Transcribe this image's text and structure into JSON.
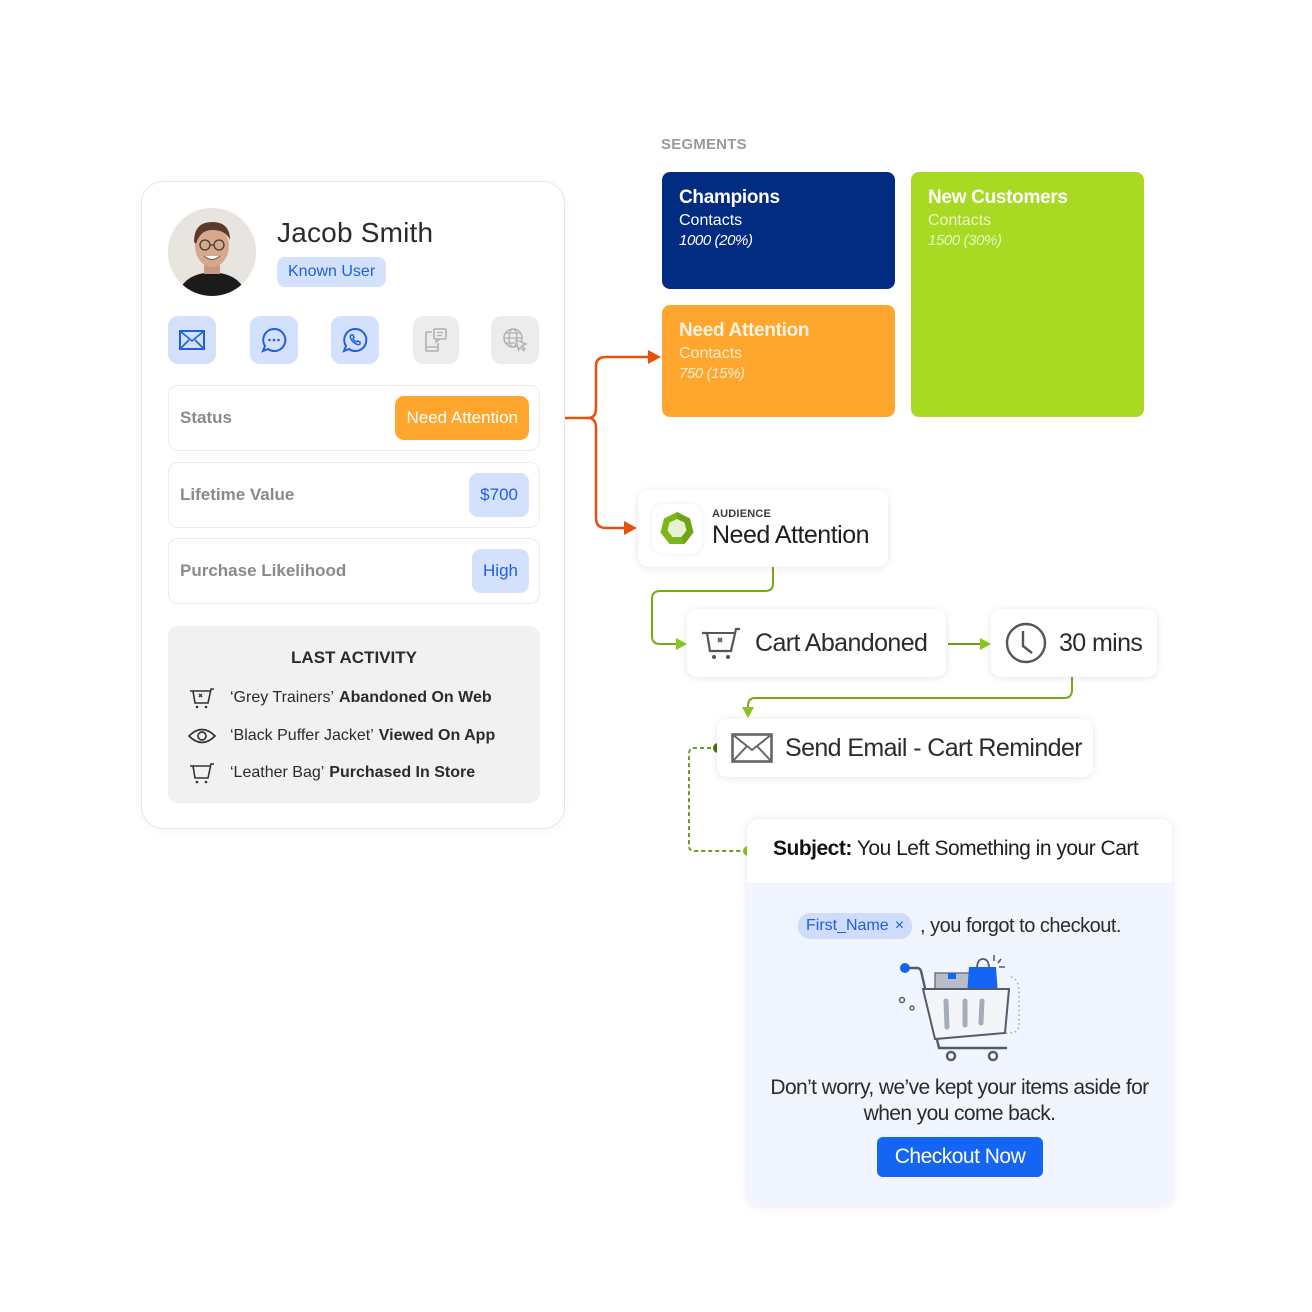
{
  "profile": {
    "name": "Jacob Smith",
    "badge": "Known User",
    "channels": [
      {
        "icon": "email-icon",
        "state": "active"
      },
      {
        "icon": "chat-bubble-icon",
        "state": "active"
      },
      {
        "icon": "whatsapp-icon",
        "state": "active"
      },
      {
        "icon": "mobile-message-icon",
        "state": "inactive"
      },
      {
        "icon": "web-globe-cursor-icon",
        "state": "inactive"
      }
    ],
    "attributes": [
      {
        "label": "Status",
        "value": "Need Attention",
        "style": "orange"
      },
      {
        "label": "Lifetime Value",
        "value": "$700",
        "style": "blue"
      },
      {
        "label": "Purchase Likelihood",
        "value": "High",
        "style": "blue"
      }
    ],
    "last_activity": {
      "title": "LAST ACTIVITY",
      "items": [
        {
          "icon": "cart-abandoned-icon",
          "item": "‘Grey Trainers’",
          "action": "Abandoned On Web"
        },
        {
          "icon": "eye-icon",
          "item": "‘Black Puffer Jacket’",
          "action": "Viewed On App"
        },
        {
          "icon": "cart-icon",
          "item": "‘Leather Bag’",
          "action": "Purchased In Store"
        }
      ]
    }
  },
  "segments": {
    "label": "SEGMENTS",
    "items": [
      {
        "name": "Champions",
        "sub": "Contacts",
        "count": "1000 (20%)",
        "color": "#022b82"
      },
      {
        "name": "New Customers",
        "sub": "Contacts",
        "count": "1500 (30%)",
        "color": "#a8d923"
      },
      {
        "name": "Need Attention",
        "sub": "Contacts",
        "count": "750 (15%)",
        "color": "#fea62e"
      }
    ]
  },
  "flow": {
    "audience": {
      "kicker": "AUDIENCE",
      "title": "Need Attention"
    },
    "trigger": {
      "label": "Cart Abandoned"
    },
    "wait": {
      "label": "30 mins"
    },
    "action": {
      "label": "Send Email - Cart Reminder"
    }
  },
  "email": {
    "subject_label": "Subject:",
    "subject": "You Left Something in your Cart",
    "token": "First_Name",
    "token_remove": "×",
    "greeting": ", you forgot to checkout.",
    "body_line1": "Don’t worry, we’ve kept your items aside for",
    "body_line2": "when you come back.",
    "cta": "Checkout Now"
  },
  "colors": {
    "accent_blue": "#1565f5",
    "orange": "#fea62e",
    "connector_orange": "#e8500e",
    "connector_green": "#8cc31c",
    "navy": "#022b82",
    "lime": "#a8d923"
  }
}
